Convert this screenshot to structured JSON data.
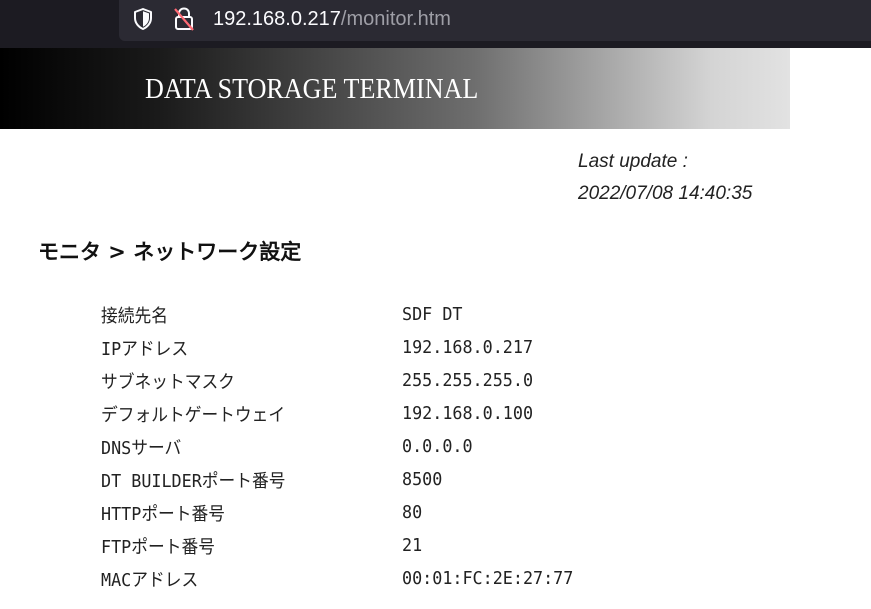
{
  "browser": {
    "url_host": "192.168.0.217",
    "url_path": "/monitor.htm",
    "icons": [
      "shield-icon",
      "insecure-lock-icon"
    ]
  },
  "banner": {
    "title": "DATA STORAGE TERMINAL"
  },
  "last_update": {
    "label": "Last update :",
    "value": "2022/07/08 14:40:35"
  },
  "heading": "モニタ > ネットワーク設定",
  "settings": [
    {
      "label": "接続先名",
      "value": "SDF DT"
    },
    {
      "label": "IPアドレス",
      "value": "192.168.0.217"
    },
    {
      "label": "サブネットマスク",
      "value": "255.255.255.0"
    },
    {
      "label": "デフォルトゲートウェイ",
      "value": "192.168.0.100"
    },
    {
      "label": "DNSサーバ",
      "value": "0.0.0.0"
    },
    {
      "label": "DT BUILDERポート番号",
      "value": "8500"
    },
    {
      "label": "HTTPポート番号",
      "value": "80"
    },
    {
      "label": "FTPポート番号",
      "value": "21"
    },
    {
      "label": "MACアドレス",
      "value": "00:01:FC:2E:27:77"
    }
  ]
}
